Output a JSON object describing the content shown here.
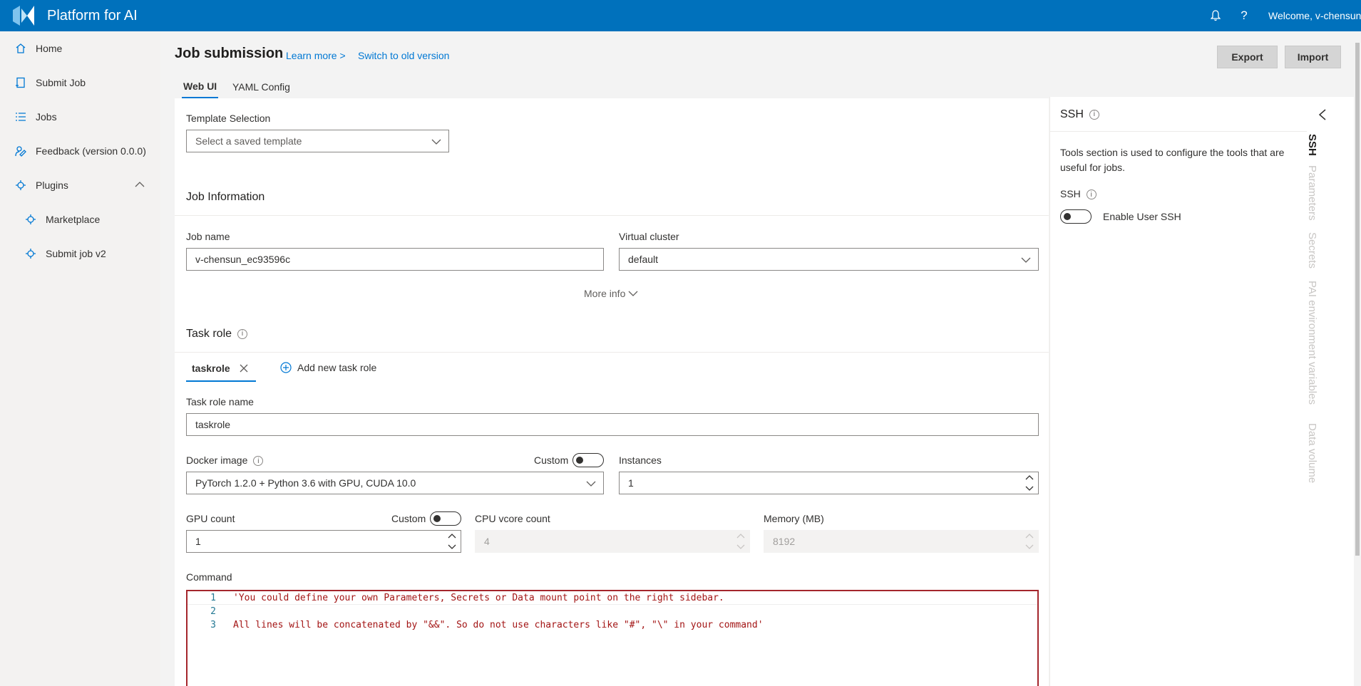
{
  "app": {
    "title": "Platform for AI",
    "welcome": "Welcome, v-chensun"
  },
  "colors": {
    "brand": "#0071bc",
    "link": "#0078d4",
    "error_border": "#a4262c"
  },
  "topbar": {
    "bell_icon": "bell-icon",
    "help_icon": "help-icon",
    "help_glyph": "?"
  },
  "sidebar": {
    "items": [
      {
        "label": "Home",
        "icon": "home-icon"
      },
      {
        "label": "Submit Job",
        "icon": "submit-icon"
      },
      {
        "label": "Jobs",
        "icon": "list-icon"
      },
      {
        "label": "Feedback (version 0.0.0)",
        "icon": "feedback-icon"
      },
      {
        "label": "Plugins",
        "icon": "plugin-icon"
      },
      {
        "label": "Marketplace",
        "icon": "plugin-icon"
      },
      {
        "label": "Submit job v2",
        "icon": "plugin-icon"
      }
    ]
  },
  "header": {
    "title": "Job submission",
    "learn_more": "Learn more >",
    "switch_old": "Switch to old version",
    "export": "Export",
    "import": "Import"
  },
  "tabs": [
    "Web UI",
    "YAML Config"
  ],
  "form": {
    "template_label": "Template Selection",
    "template_placeholder": "Select a saved template",
    "job_info_title": "Job Information",
    "job_name_label": "Job name",
    "job_name_value": "v-chensun_ec93596c",
    "virtual_cluster_label": "Virtual cluster",
    "virtual_cluster_value": "default",
    "more_info": "More info",
    "task_role_title": "Task role",
    "task_role_tab": "taskrole",
    "add_task_role": "Add new task role",
    "task_role_name_label": "Task role name",
    "task_role_name_value": "taskrole",
    "docker_label": "Docker image",
    "custom_label": "Custom",
    "docker_value": "PyTorch 1.2.0 + Python 3.6 with GPU, CUDA 10.0",
    "instances_label": "Instances",
    "instances_value": "1",
    "gpu_label": "GPU count",
    "gpu_value": "1",
    "cpu_label": "CPU vcore count",
    "cpu_value": "4",
    "memory_label": "Memory (MB)",
    "memory_value": "8192",
    "command_label": "Command",
    "command_lines": [
      {
        "num": "1",
        "text": "'You could define your own Parameters, Secrets or Data mount point on the right sidebar."
      },
      {
        "num": "2",
        "text": ""
      },
      {
        "num": "3",
        "text": "All lines will be concatenated by \"&&\". So do not use characters like \"#\", \"\\\" in your command'"
      }
    ]
  },
  "right_panel": {
    "title": "SSH",
    "description": "Tools section is used to configure the tools that are useful for jobs.",
    "ssh_label": "SSH",
    "enable_label": "Enable User SSH",
    "vertical_tabs": [
      "SSH",
      "Parameters",
      "Secrets",
      "PAI environment variables",
      "Data volume"
    ]
  }
}
